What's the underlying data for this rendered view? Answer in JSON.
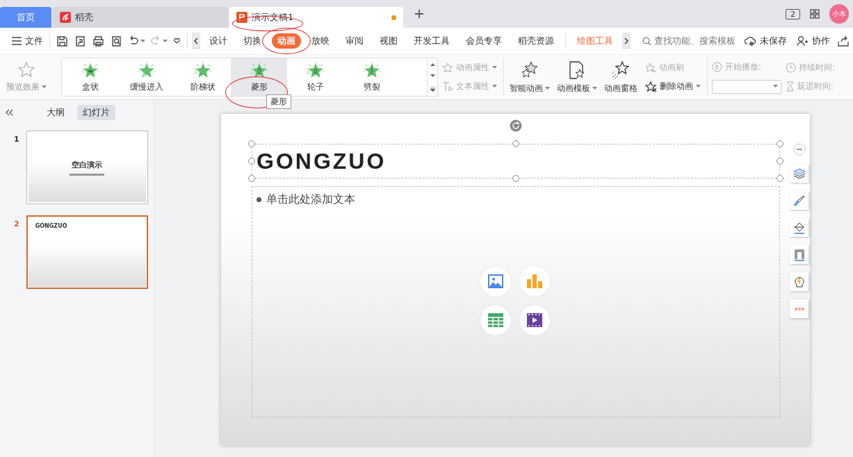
{
  "tabs": [
    {
      "kind": "home",
      "label": "首页",
      "selected": false,
      "modified": false,
      "circled": false
    },
    {
      "kind": "app",
      "label": "稻壳",
      "selected": false,
      "modified": false,
      "circled": false
    },
    {
      "kind": "doc",
      "label": "演示文稿1",
      "selected": true,
      "modified": true,
      "circled": true
    }
  ],
  "title_bar": {
    "window_count": "2",
    "avatar": "小木"
  },
  "menu": {
    "file": "文件",
    "ribbon_tabs": [
      {
        "label": "设计",
        "kind": "normal",
        "selected": false,
        "circled": false
      },
      {
        "label": "切换",
        "kind": "normal",
        "selected": false,
        "circled": false
      },
      {
        "label": "动画",
        "kind": "normal",
        "selected": true,
        "circled": true
      },
      {
        "label": "放映",
        "kind": "normal",
        "selected": false,
        "circled": false
      },
      {
        "label": "审阅",
        "kind": "normal",
        "selected": false,
        "circled": false
      },
      {
        "label": "视图",
        "kind": "normal",
        "selected": false,
        "circled": false
      },
      {
        "label": "开发工具",
        "kind": "normal",
        "selected": false,
        "circled": false
      },
      {
        "label": "会员专享",
        "kind": "normal",
        "selected": false,
        "circled": false
      },
      {
        "label": "稻壳资源",
        "kind": "normal",
        "selected": false,
        "circled": false
      },
      {
        "label": "绘图工具",
        "kind": "contextual",
        "selected": false,
        "circled": false
      }
    ],
    "search": {
      "placeholder": "查找功能、搜索模板"
    },
    "save_status": "未保存",
    "collaborate": "协作"
  },
  "ribbon": {
    "preview": "预览效果",
    "effects": [
      {
        "label": "盒状",
        "selected": false,
        "circled": false
      },
      {
        "label": "缓慢进入",
        "selected": false,
        "circled": false
      },
      {
        "label": "阶梯状",
        "selected": false,
        "circled": false
      },
      {
        "label": "菱形",
        "selected": true,
        "circled": true
      },
      {
        "label": "轮子",
        "selected": false,
        "circled": false
      },
      {
        "label": "劈裂",
        "selected": false,
        "circled": false
      }
    ],
    "properties": [
      {
        "label": "动画属性",
        "disabled": true
      },
      {
        "label": "文本属性",
        "disabled": true
      }
    ],
    "big_buttons": [
      {
        "label": "智能动画",
        "dropdown": true
      },
      {
        "label": "动画模板",
        "dropdown": true
      },
      {
        "label": "动画窗格",
        "dropdown": false
      }
    ],
    "brush": {
      "label": "动画刷",
      "disabled": true
    },
    "delete": {
      "label": "删除动画",
      "disabled": false
    },
    "start": {
      "label": "开始播放:",
      "disabled": true
    },
    "duration": {
      "label": "持续时间:",
      "disabled": true
    },
    "delay": {
      "label": "延迟时间:",
      "disabled": true
    }
  },
  "tooltip": "菱形",
  "sidebar": {
    "views": [
      {
        "label": "大纲",
        "selected": false
      },
      {
        "label": "幻灯片",
        "selected": true
      }
    ],
    "slides": [
      {
        "number": "1",
        "kind": "title",
        "title": "空白演示",
        "selected": false
      },
      {
        "number": "2",
        "kind": "content",
        "title": "GONGZUO",
        "selected": true
      }
    ]
  },
  "slide": {
    "title": "GONGZUO",
    "body_placeholder": "单击此处添加文本"
  }
}
